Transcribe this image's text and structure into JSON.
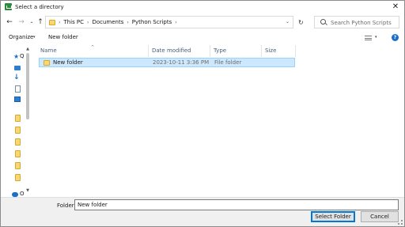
{
  "window": {
    "title": "Select a directory",
    "close_glyph": "✕"
  },
  "nav": {
    "back_glyph": "←",
    "forward_glyph": "→",
    "recent_glyph": "⌄",
    "up_glyph": "↑",
    "refresh_glyph": "↻"
  },
  "address": {
    "breadcrumbs": [
      "This PC",
      "Documents",
      "Python Scripts"
    ],
    "separator": "›",
    "dropdown_glyph": "⌄"
  },
  "search": {
    "placeholder": "Search Python Scripts",
    "value": ""
  },
  "toolbar": {
    "organize_label": "Organize",
    "organize_arrow": "▾",
    "new_folder_label": "New folder",
    "view_arrow": "▾",
    "help_glyph": "?"
  },
  "navpane": {
    "items": [
      {
        "icon": "quick-access-star-icon",
        "label": "Q"
      },
      {
        "icon": "desktop-icon"
      },
      {
        "icon": "downloads-icon",
        "glyph": "↓"
      },
      {
        "icon": "documents-icon"
      },
      {
        "icon": "pictures-icon"
      },
      {
        "icon": "folder-icon"
      },
      {
        "icon": "folder-icon"
      },
      {
        "icon": "folder-icon"
      },
      {
        "icon": "folder-icon"
      },
      {
        "icon": "folder-icon"
      },
      {
        "icon": "folder-icon"
      },
      {
        "icon": "onedrive-icon",
        "label": "O"
      }
    ],
    "scroll_up": "▲",
    "scroll_down": "▼"
  },
  "table": {
    "columns": [
      "Name",
      "Date modified",
      "Type",
      "Size"
    ],
    "sort_glyph": "^",
    "rows": [
      {
        "name": "New folder",
        "date": "2023-10-11 3:36 PM",
        "type": "File folder",
        "size": "",
        "selected": true
      }
    ]
  },
  "footer": {
    "folder_label": "Folder:",
    "folder_value": "New folder",
    "select_button": "Select Folder",
    "cancel_button": "Cancel"
  },
  "colors": {
    "selection_bg": "#cce8ff",
    "selection_border": "#99d1ff",
    "accent": "#0078d7",
    "folder": "#f8d775"
  }
}
